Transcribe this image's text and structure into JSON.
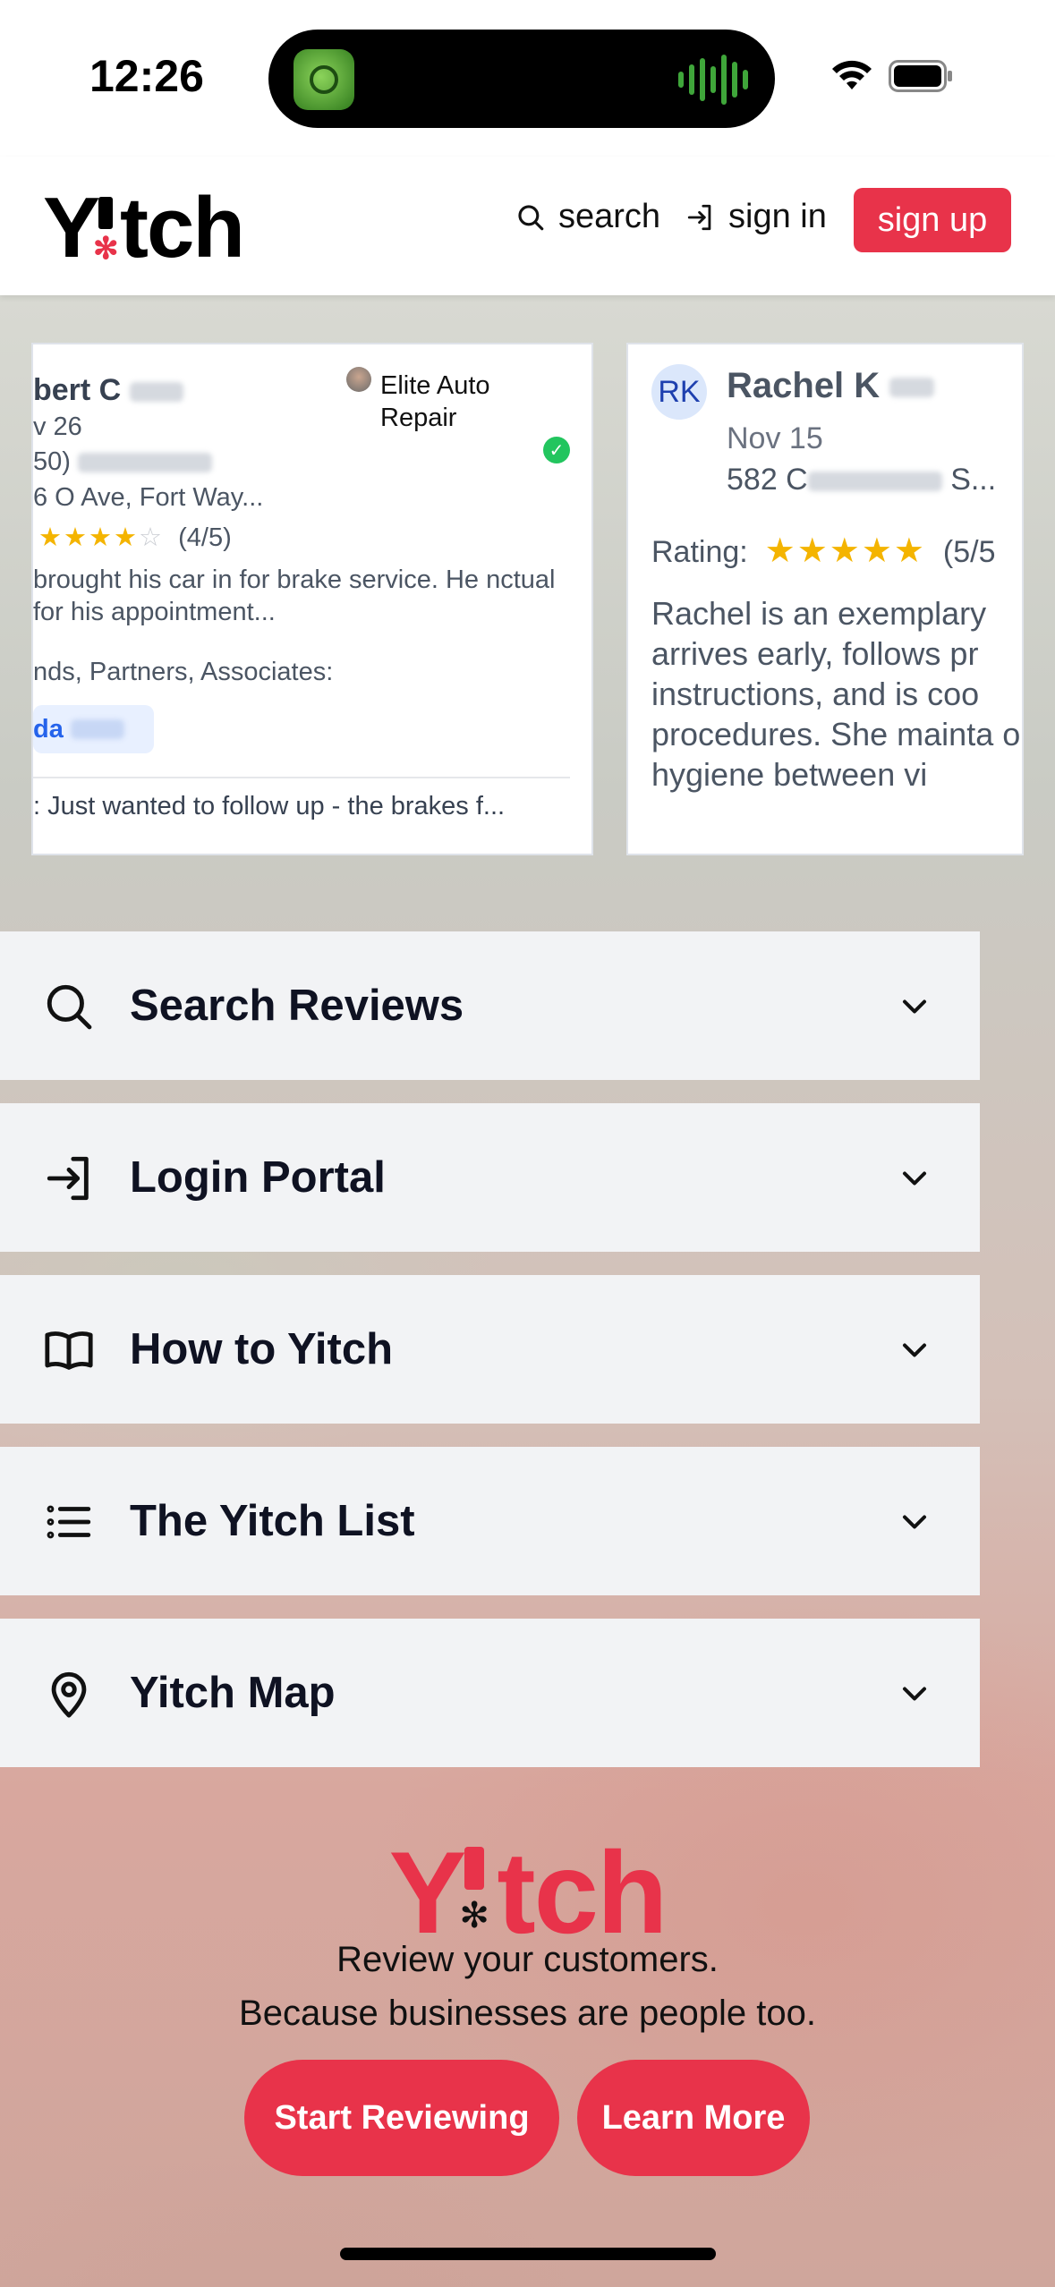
{
  "status_bar": {
    "time": "12:26"
  },
  "header": {
    "logo": {
      "left": "Y",
      "right": "tch"
    },
    "search_label": "search",
    "signin_label": "sign in",
    "signup_label": "sign up"
  },
  "reviews": [
    {
      "name": "bert C",
      "date": "v 26",
      "phone": "50)",
      "address": "6 O   Ave, Fort Way...",
      "business": "Elite Auto Repair",
      "rating_text": "(4/5)",
      "rating": 4,
      "text": "brought his car in for brake service. He nctual for his appointment...",
      "associates_label": "nds, Partners, Associates:",
      "associate_chip": "da",
      "followup": ": Just wanted to follow up - the brakes f..."
    },
    {
      "initials": "RK",
      "name": "Rachel K",
      "date": "Nov 15",
      "address": "582 C",
      "address_tail": "S...",
      "rating_label": "Rating:",
      "rating_text": "(5/5",
      "rating": 5,
      "text": "Rachel is an exemplary arrives early, follows pr instructions, and is coo procedures. She mainta oral hygiene between vi"
    }
  ],
  "accordion": [
    {
      "label": "Search Reviews",
      "icon": "search-icon"
    },
    {
      "label": "Login Portal",
      "icon": "login-icon"
    },
    {
      "label": "How to Yitch",
      "icon": "book-icon"
    },
    {
      "label": "The Yitch List",
      "icon": "list-icon"
    },
    {
      "label": "Yitch Map",
      "icon": "map-pin-icon"
    }
  ],
  "hero": {
    "logo_left": "Y",
    "logo_right": "tch",
    "tagline1": "Review your customers.",
    "tagline2": "Because businesses are people too.",
    "start_button": "Start Reviewing",
    "learn_button": "Learn More"
  },
  "colors": {
    "accent": "#e8334a",
    "panel": "#f2f3f5",
    "star": "#f4b400"
  }
}
